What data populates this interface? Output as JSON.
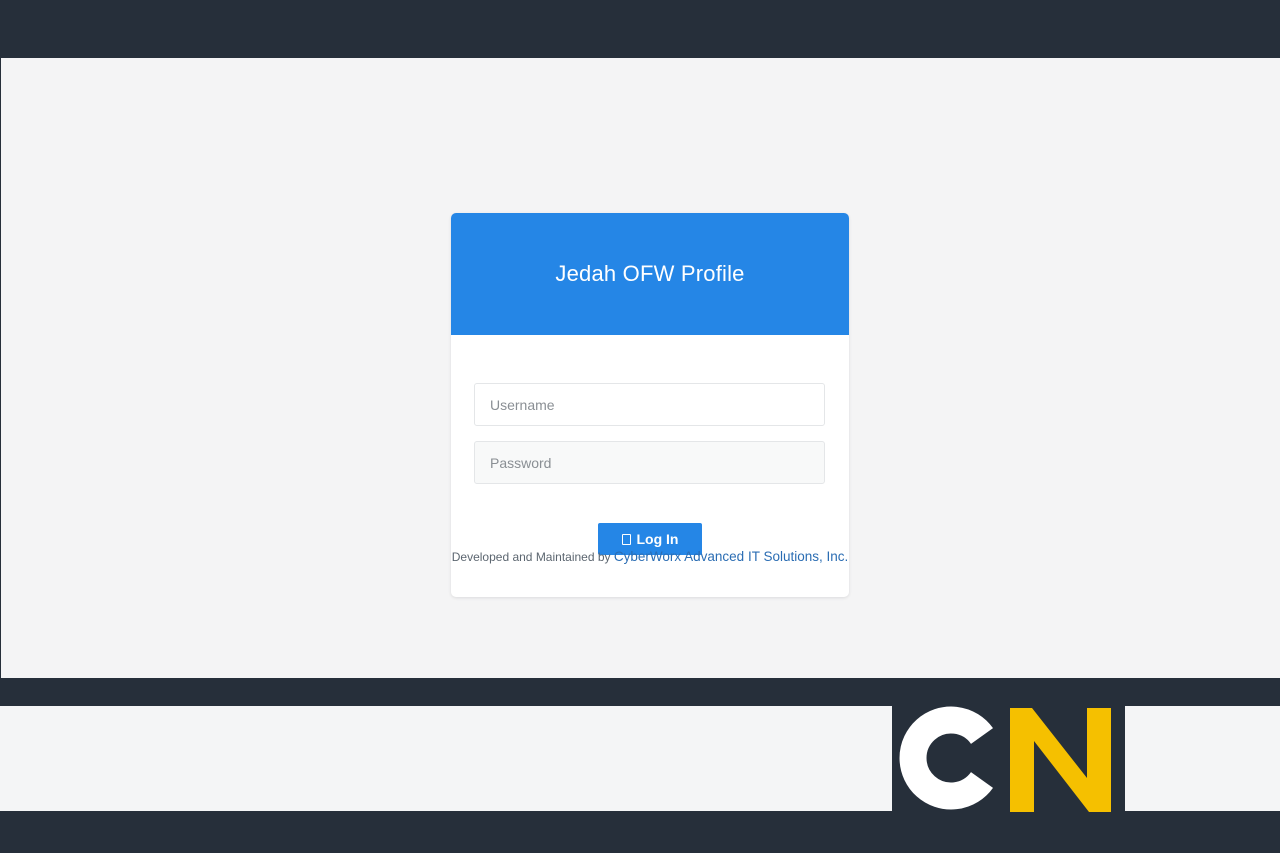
{
  "login": {
    "title": "Jedah OFW Profile",
    "username_placeholder": "Username",
    "password_placeholder": "Password",
    "login_label": "Log In",
    "login_icon": "login-icon"
  },
  "footer": {
    "prefix": "Developed and Maintained by ",
    "company": "CyberWorx Advanced IT Solutions, Inc."
  },
  "logo": {
    "text": "CN",
    "colors": {
      "c": "#ffffff",
      "n": "#f5c000",
      "background": "#262f3a"
    }
  },
  "colors": {
    "accent": "#2586e6",
    "frame": "#262f3a",
    "page_background": "#f4f4f5"
  }
}
